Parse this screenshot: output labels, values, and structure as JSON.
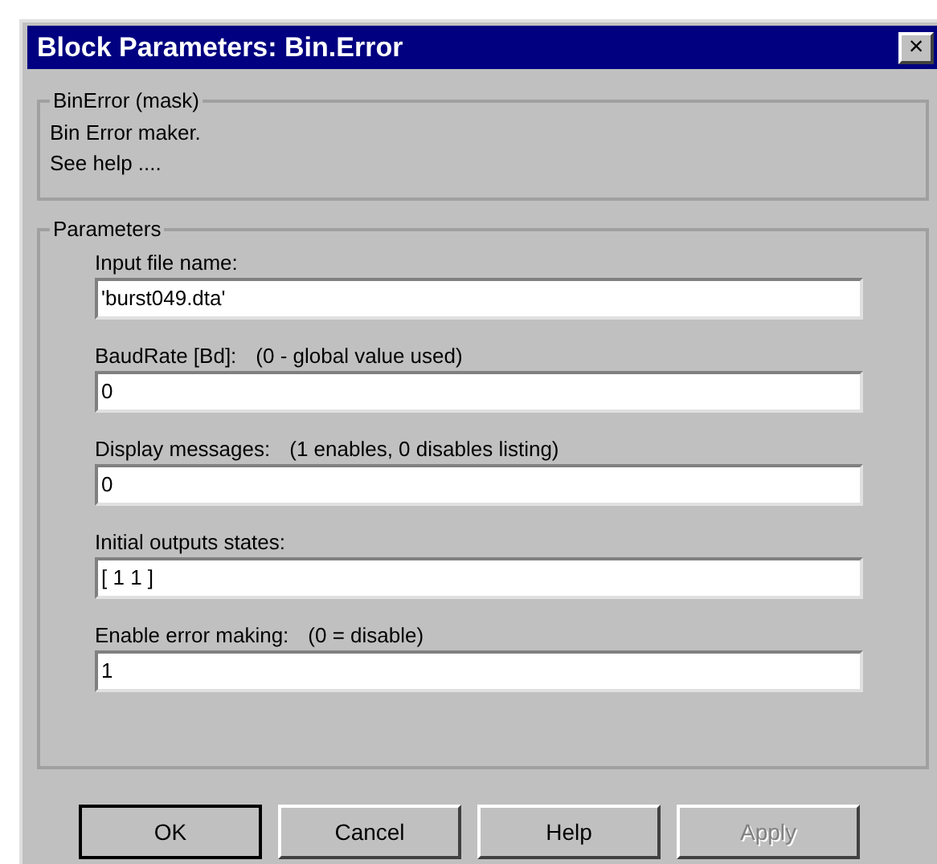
{
  "window": {
    "title": "Block Parameters: Bin.Error",
    "close": "×"
  },
  "mask": {
    "title": "BinError (mask)",
    "lines": [
      "Bin Error maker.",
      "See help ...."
    ]
  },
  "parameters": {
    "title": "Parameters",
    "fields": [
      {
        "label": "Input file name:",
        "value": "'burst049.dta'"
      },
      {
        "label": "BaudRate [Bd]:",
        "hint": "(0 - global value used)",
        "value": "0"
      },
      {
        "label": "Display messages:",
        "hint": "(1 enables, 0 disables listing)",
        "value": "0"
      },
      {
        "label": "Initial outputs states:",
        "value": "[ 1 1 ]"
      },
      {
        "label": "Enable error making:",
        "hint": "(0 = disable)",
        "value": "1"
      }
    ]
  },
  "buttons": [
    {
      "label": "OK",
      "default": true,
      "disabled": false
    },
    {
      "label": "Cancel",
      "default": false,
      "disabled": false
    },
    {
      "label": "Help",
      "default": false,
      "disabled": false
    },
    {
      "label": "Apply",
      "default": false,
      "disabled": true
    }
  ]
}
